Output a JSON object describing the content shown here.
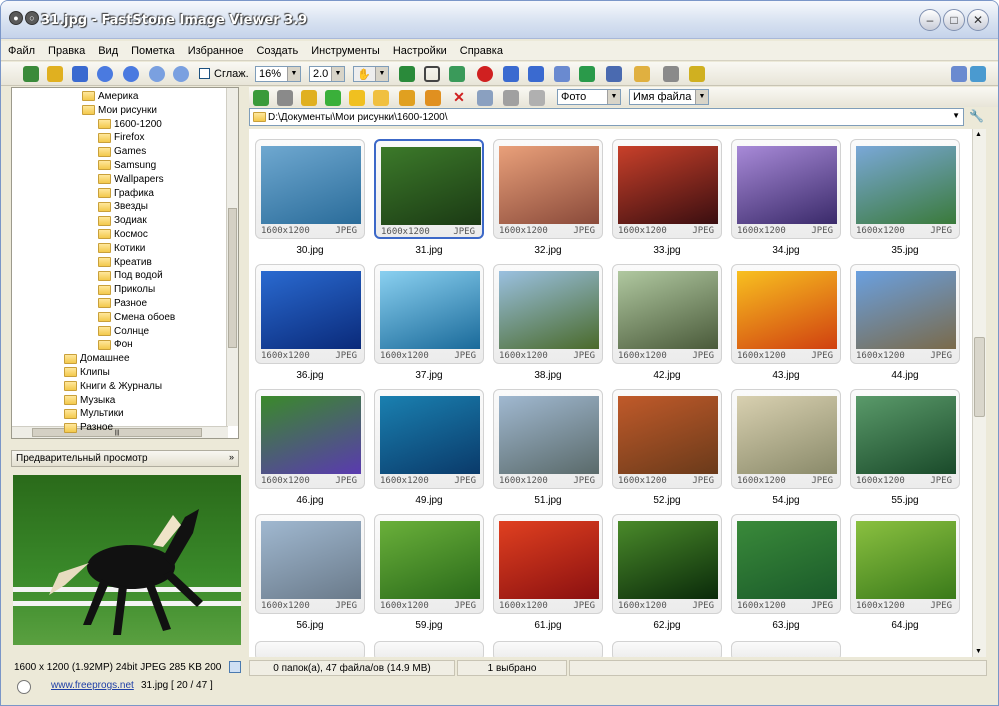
{
  "app": {
    "title": "31.jpg - FastStone Image Viewer 3.9"
  },
  "menu": [
    "Файл",
    "Правка",
    "Вид",
    "Пометка",
    "Избранное",
    "Создать",
    "Инструменты",
    "Настройки",
    "Справка"
  ],
  "toolbar": {
    "smooth_label": "Сглаж.",
    "zoom": "16%",
    "gamma": "2.0"
  },
  "tree": {
    "items": [
      {
        "label": "Америка",
        "indent": 1
      },
      {
        "label": "Мои рисунки",
        "indent": 1
      },
      {
        "label": "1600-1200",
        "indent": 2
      },
      {
        "label": "Firefox",
        "indent": 2
      },
      {
        "label": "Games",
        "indent": 2
      },
      {
        "label": "Samsung",
        "indent": 2
      },
      {
        "label": "Wallpapers",
        "indent": 2
      },
      {
        "label": "Графика",
        "indent": 2
      },
      {
        "label": "Звезды",
        "indent": 2
      },
      {
        "label": "Зодиак",
        "indent": 2
      },
      {
        "label": "Космос",
        "indent": 2
      },
      {
        "label": "Котики",
        "indent": 2
      },
      {
        "label": "Креатив",
        "indent": 2
      },
      {
        "label": "Под водой",
        "indent": 2
      },
      {
        "label": "Приколы",
        "indent": 2
      },
      {
        "label": "Разное",
        "indent": 2
      },
      {
        "label": "Смена обоев",
        "indent": 2
      },
      {
        "label": "Солнце",
        "indent": 2
      },
      {
        "label": "Фон",
        "indent": 2
      },
      {
        "label": "Домашнее",
        "indent": 0
      },
      {
        "label": "Клипы",
        "indent": 0
      },
      {
        "label": "Книги & Журналы",
        "indent": 0
      },
      {
        "label": "Музыка",
        "indent": 0
      },
      {
        "label": "Мультики",
        "indent": 0
      },
      {
        "label": "Разное",
        "indent": 0
      }
    ]
  },
  "preview": {
    "header": "Предварительный просмотр"
  },
  "status_left": {
    "info": "1600 x 1200 (1.92MP)  24bit JPEG  285 KB  200"
  },
  "right_toolbar": {
    "sort_type": "Фото",
    "sort_field": "Имя файла"
  },
  "path": "D:\\Документы\\Мои рисунки\\1600-1200\\",
  "thumbnails": [
    {
      "name": "30.jpg",
      "dims": "1600x1200",
      "fmt": "JPEG",
      "c1": "#6fa8d0",
      "c2": "#2a6c9a"
    },
    {
      "name": "31.jpg",
      "dims": "1600x1200",
      "fmt": "JPEG",
      "c1": "#3c7a2a",
      "c2": "#1b3a14",
      "selected": true
    },
    {
      "name": "32.jpg",
      "dims": "1600x1200",
      "fmt": "JPEG",
      "c1": "#e9a07a",
      "c2": "#8a4a3a"
    },
    {
      "name": "33.jpg",
      "dims": "1600x1200",
      "fmt": "JPEG",
      "c1": "#c8402a",
      "c2": "#3a0e10"
    },
    {
      "name": "34.jpg",
      "dims": "1600x1200",
      "fmt": "JPEG",
      "c1": "#a88ad8",
      "c2": "#3a2a6a"
    },
    {
      "name": "35.jpg",
      "dims": "1600x1200",
      "fmt": "JPEG",
      "c1": "#7aa8d8",
      "c2": "#3a7a3a"
    },
    {
      "name": "36.jpg",
      "dims": "1600x1200",
      "fmt": "JPEG",
      "c1": "#2a6ad0",
      "c2": "#0a2a7a"
    },
    {
      "name": "37.jpg",
      "dims": "1600x1200",
      "fmt": "JPEG",
      "c1": "#8ad0f0",
      "c2": "#1a6a9a"
    },
    {
      "name": "38.jpg",
      "dims": "1600x1200",
      "fmt": "JPEG",
      "c1": "#9ac0e0",
      "c2": "#4a6a2a"
    },
    {
      "name": "42.jpg",
      "dims": "1600x1200",
      "fmt": "JPEG",
      "c1": "#b0c8a0",
      "c2": "#4a5a3a"
    },
    {
      "name": "43.jpg",
      "dims": "1600x1200",
      "fmt": "JPEG",
      "c1": "#f8c020",
      "c2": "#d04010"
    },
    {
      "name": "44.jpg",
      "dims": "1600x1200",
      "fmt": "JPEG",
      "c1": "#6aa0e0",
      "c2": "#7a6a4a"
    },
    {
      "name": "46.jpg",
      "dims": "1600x1200",
      "fmt": "JPEG",
      "c1": "#3a8a2a",
      "c2": "#5a3ab0"
    },
    {
      "name": "49.jpg",
      "dims": "1600x1200",
      "fmt": "JPEG",
      "c1": "#1a80b0",
      "c2": "#0a3a6a"
    },
    {
      "name": "51.jpg",
      "dims": "1600x1200",
      "fmt": "JPEG",
      "c1": "#a0b8d0",
      "c2": "#5a6a6a"
    },
    {
      "name": "52.jpg",
      "dims": "1600x1200",
      "fmt": "JPEG",
      "c1": "#c05a2a",
      "c2": "#6a3a1a"
    },
    {
      "name": "54.jpg",
      "dims": "1600x1200",
      "fmt": "JPEG",
      "c1": "#d8d0b0",
      "c2": "#8a8a6a"
    },
    {
      "name": "55.jpg",
      "dims": "1600x1200",
      "fmt": "JPEG",
      "c1": "#5a9a6a",
      "c2": "#1a4a2a"
    },
    {
      "name": "56.jpg",
      "dims": "1600x1200",
      "fmt": "JPEG",
      "c1": "#a0b8d0",
      "c2": "#6a7a8a"
    },
    {
      "name": "59.jpg",
      "dims": "1600x1200",
      "fmt": "JPEG",
      "c1": "#6ab03a",
      "c2": "#2a6a1a"
    },
    {
      "name": "61.jpg",
      "dims": "1600x1200",
      "fmt": "JPEG",
      "c1": "#e04020",
      "c2": "#8a1010"
    },
    {
      "name": "62.jpg",
      "dims": "1600x1200",
      "fmt": "JPEG",
      "c1": "#4a8a2a",
      "c2": "#0a2a0a"
    },
    {
      "name": "63.jpg",
      "dims": "1600x1200",
      "fmt": "JPEG",
      "c1": "#3a8a3a",
      "c2": "#1a5a2a"
    },
    {
      "name": "64.jpg",
      "dims": "1600x1200",
      "fmt": "JPEG",
      "c1": "#8ac040",
      "c2": "#3a7a1a"
    }
  ],
  "status": {
    "count": "0 папок(а), 47 файла/ов (14.9 MB)",
    "selected": "1 выбрано"
  },
  "bottom": {
    "link": "www.freeprogs.net",
    "file": "31.jpg [ 20 / 47 ]"
  }
}
